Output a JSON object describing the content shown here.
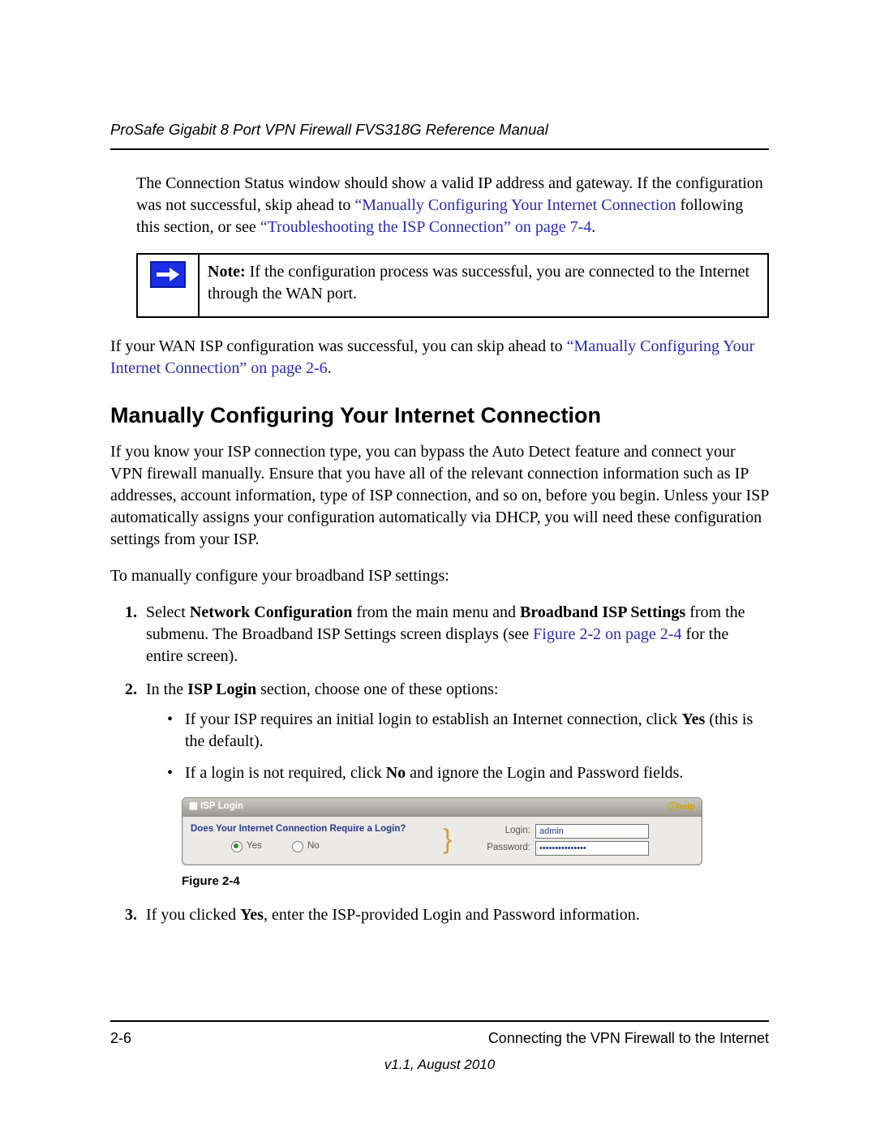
{
  "header": {
    "running_title": "ProSafe Gigabit 8 Port VPN Firewall FVS318G Reference Manual"
  },
  "intro": {
    "p1_a": "The Connection Status window should show a valid IP address and gateway. If the configuration was not successful, skip ahead to ",
    "p1_link1": "“Manually Configuring Your Internet Connection",
    "p1_b": " following this section, or see ",
    "p1_link2": "“Troubleshooting the ISP Connection” on page 7-4",
    "p1_c": "."
  },
  "note": {
    "label": "Note:",
    "text": " If the configuration process was successful, you are connected to the Internet through the WAN port."
  },
  "after_note": {
    "a": "If your WAN ISP configuration was successful, you can skip ahead to ",
    "link": "“Manually Configuring Your Internet Connection” on page 2-6",
    "b": "."
  },
  "section": {
    "title": "Manually Configuring Your Internet Connection",
    "p1": "If you know your ISP connection type, you can bypass the Auto Detect feature and connect your VPN firewall manually. Ensure that you have all of the relevant connection information such as IP addresses, account information, type of ISP connection, and so on, before you begin. Unless your ISP automatically assigns your configuration automatically via DHCP, you will need these configuration settings from your ISP.",
    "p2": "To manually configure your broadband ISP settings:"
  },
  "steps": {
    "s1_a": "Select ",
    "s1_b1": "Network Configuration",
    "s1_c": " from the main menu and ",
    "s1_b2": "Broadband ISP Settings",
    "s1_d": " from the submenu. The Broadband ISP Settings screen displays (see ",
    "s1_link": "Figure 2-2 on page 2-4",
    "s1_e": " for the entire screen).",
    "s2_a": "In the ",
    "s2_b": "ISP Login",
    "s2_c": " section, choose one of these options:",
    "s2_li1_a": "If your ISP requires an initial login to establish an Internet connection, click ",
    "s2_li1_b": "Yes",
    "s2_li1_c": " (this is the default).",
    "s2_li2_a": "If a login is not required, click ",
    "s2_li2_b": "No",
    "s2_li2_c": " and ignore the Login and Password fields.",
    "s3_a": "If you clicked ",
    "s3_b": "Yes",
    "s3_c": ", enter the ISP-provided Login and Password information."
  },
  "ui": {
    "title": "ISP Login",
    "help": "help",
    "question": "Does Your Internet Connection Require a Login?",
    "yes": "Yes",
    "no": "No",
    "login_label": "Login:",
    "password_label": "Password:",
    "login_value": "admin",
    "password_value": "•••••••••••••••"
  },
  "figure_caption": "Figure 2-4",
  "footer": {
    "page": "2-6",
    "chapter": "Connecting the VPN Firewall to the Internet",
    "version": "v1.1, August 2010"
  }
}
